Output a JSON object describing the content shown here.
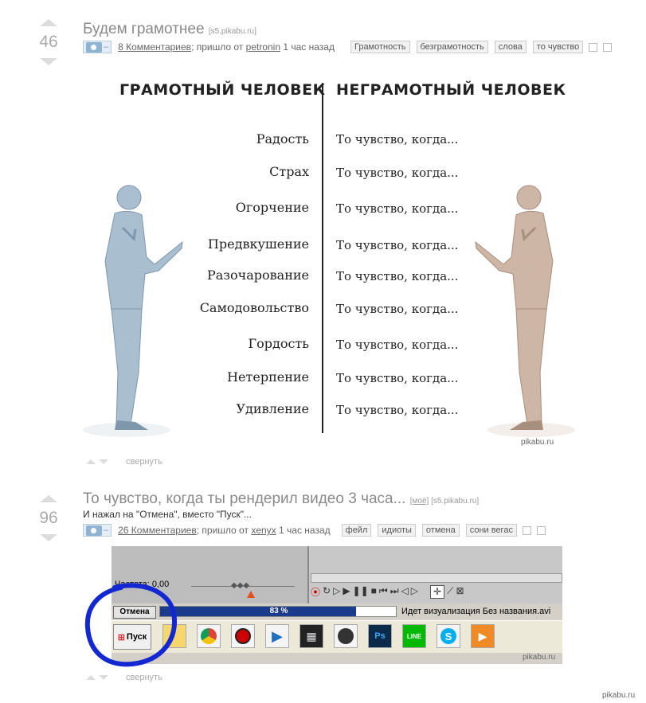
{
  "post1": {
    "score": "46",
    "title": "Будем грамотнее",
    "source": "[s5.pikabu.ru]",
    "comments": "8 Комментариев",
    "from_text": "; пришло от",
    "author": "petronin",
    "time": "1 час назад",
    "tags": [
      "Грамотность",
      "безграмотность",
      "слова",
      "то чувство"
    ],
    "image": {
      "left_heading": "ГРАМОТНЫЙ ЧЕЛОВЕК",
      "right_heading": "НЕГРАМОТНЫЙ ЧЕЛОВЕК",
      "emotions": [
        "Радость",
        "Страх",
        "Огорчение",
        "Предвкушение",
        "Разочарование",
        "Самодовольство",
        "Гордость",
        "Нетерпение",
        "Удивление"
      ],
      "feeling": "То чувство, когда...",
      "watermark": "pikabu.ru"
    },
    "collapse": "свернуть"
  },
  "post2": {
    "score": "96",
    "title": "То чувство, когда ты рендерил видео 3 часа...",
    "mine_tag": "[моё]",
    "source": "[s5.pikabu.ru]",
    "description": "И нажал на \"Отмена\", вместо \"Пуск\"...",
    "comments": "26 Комментариев",
    "from_text": "; пришло от",
    "author": "xenyx",
    "time": "1 час назад",
    "tags": [
      "фейл",
      "идиоты",
      "отмена",
      "сони вегас"
    ],
    "image": {
      "freq_label": "Частота: 0,00",
      "cancel_label": "Отмена",
      "progress_text": "83 %",
      "progress_value": 0.83,
      "status_text": "Идет визуализация Без названия.avi",
      "start_label": "Пуск",
      "watermark": "pikabu.ru"
    },
    "collapse": "свернуть"
  },
  "footer_watermark": "pikabu.ru",
  "colors": {
    "accent": "#8fb4d3",
    "progress": "#1b3b8c",
    "circle": "#1428d2",
    "man_left": "#a9bfd0",
    "man_right": "#cdb6a5"
  }
}
